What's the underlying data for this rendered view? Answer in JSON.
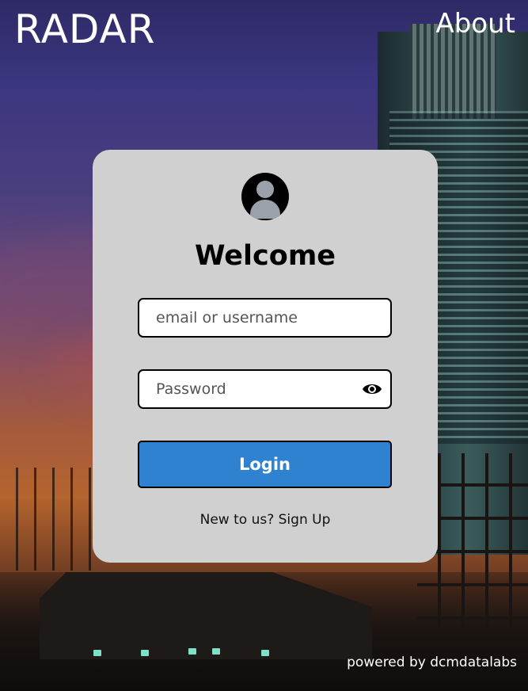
{
  "header": {
    "brand": "RADAR",
    "about_label": "About"
  },
  "login_card": {
    "avatar_icon": "user-circle-icon",
    "heading": "Welcome",
    "email_placeholder": "email or username",
    "password_placeholder": "Password",
    "password_toggle_icon": "eye-icon",
    "login_label": "Login",
    "signup_prompt": "New to us?",
    "signup_link": "Sign Up"
  },
  "footer": {
    "powered_by": "powered by dcmdatalabs"
  },
  "colors": {
    "card_bg": "#d0d0d0",
    "login_button": "#2f82d0",
    "text_light": "#ffffff"
  }
}
